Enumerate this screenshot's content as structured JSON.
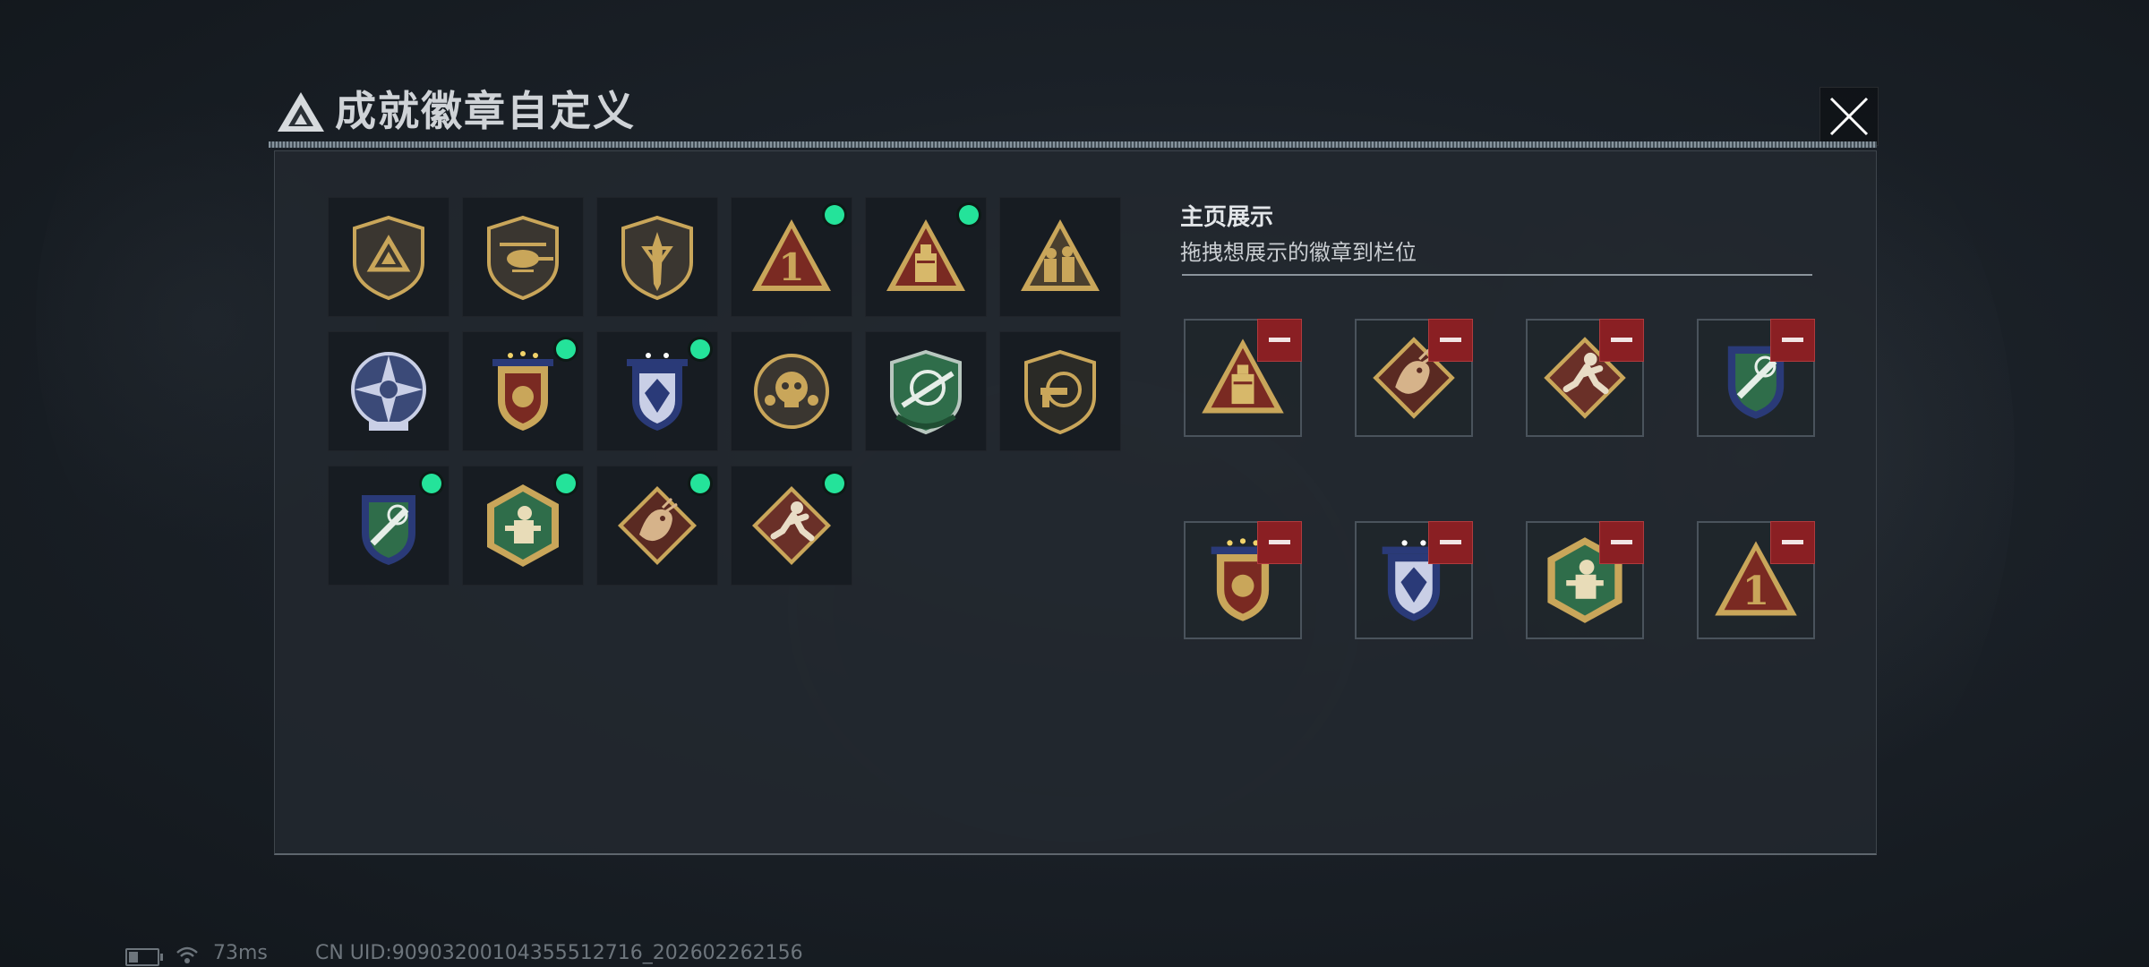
{
  "dialog": {
    "title": "成就徽章自定义",
    "close_icon": "close-icon",
    "logo_icon": "triangle-logo-icon"
  },
  "badge_library": {
    "badges": [
      {
        "icon": "triangle-shield-badge",
        "new": false
      },
      {
        "icon": "helicopter-shield-badge",
        "new": false
      },
      {
        "icon": "dagger-shield-badge",
        "new": false
      },
      {
        "icon": "number-one-triangle-badge",
        "new": true
      },
      {
        "icon": "bomb-triangle-badge",
        "new": true
      },
      {
        "icon": "soldiers-triangle-badge",
        "new": false
      },
      {
        "icon": "star-compass-badge",
        "new": false
      },
      {
        "icon": "gold-laurel-crest-badge",
        "new": true
      },
      {
        "icon": "blue-diamond-crest-badge",
        "new": true
      },
      {
        "icon": "skull-medallion-badge",
        "new": false
      },
      {
        "icon": "green-rifle-shield-badge",
        "new": false
      },
      {
        "icon": "dark-pistol-shield-badge",
        "new": false
      },
      {
        "icon": "blue-knife-crest-badge",
        "new": true
      },
      {
        "icon": "hexagon-soldier-badge",
        "new": true
      },
      {
        "icon": "dragon-diamond-badge",
        "new": true
      },
      {
        "icon": "runner-diamond-badge",
        "new": true
      }
    ]
  },
  "showcase": {
    "title": "主页展示",
    "subtitle": "拖拽想展示的徽章到栏位",
    "remove_icon": "minus-icon",
    "slots": [
      {
        "icon": "bomb-triangle-badge"
      },
      {
        "icon": "dragon-diamond-badge"
      },
      {
        "icon": "runner-diamond-badge"
      },
      {
        "icon": "blue-knife-crest-badge"
      },
      {
        "icon": "gold-laurel-crest-badge"
      },
      {
        "icon": "blue-diamond-crest-badge"
      },
      {
        "icon": "hexagon-soldier-badge"
      },
      {
        "icon": "number-one-triangle-badge"
      }
    ]
  },
  "status_bar": {
    "ping": "73ms",
    "uid": "CN UID:90903200104355512716_202602262156",
    "battery_icon": "battery-icon",
    "wifi_icon": "wifi-icon"
  },
  "colors": {
    "new_indicator": "#24e39a",
    "remove_button": "#8a1f23",
    "gold": "#c9a65a"
  }
}
